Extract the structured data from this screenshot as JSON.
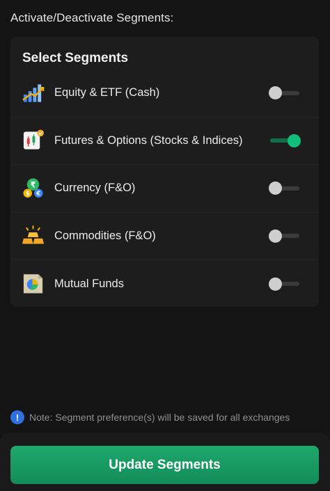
{
  "header": {
    "title": "Activate/Deactivate Segments:"
  },
  "card": {
    "title": "Select Segments",
    "segments": [
      {
        "label": "Equity & ETF (Cash)",
        "icon": "bar-chart-icon",
        "enabled": false
      },
      {
        "label": "Futures & Options (Stocks & Indices)",
        "icon": "candlestick-icon",
        "enabled": true
      },
      {
        "label": "Currency (F&O)",
        "icon": "currency-coins-icon",
        "enabled": false
      },
      {
        "label": "Commodities (F&O)",
        "icon": "gold-bars-icon",
        "enabled": false
      },
      {
        "label": "Mutual Funds",
        "icon": "pie-chart-document-icon",
        "enabled": false
      }
    ]
  },
  "note": {
    "text": "Note: Segment preference(s) will be saved for all exchanges"
  },
  "footer": {
    "button_label": "Update Segments"
  },
  "colors": {
    "accent": "#10c07a",
    "button": "#1ea86c",
    "background": "#141414",
    "card": "#1d1d1d"
  }
}
